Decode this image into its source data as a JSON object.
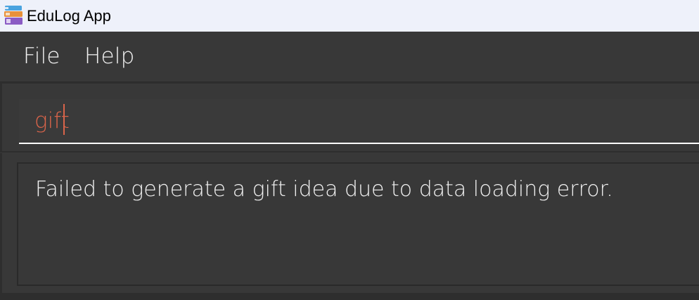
{
  "window": {
    "title": "EduLog App",
    "icon": "books-icon"
  },
  "menubar": {
    "items": [
      {
        "label": "File"
      },
      {
        "label": "Help"
      }
    ]
  },
  "command": {
    "value": "gift",
    "text_color": "#d9644a"
  },
  "result": {
    "message": "Failed to generate a gift idea due to data loading error."
  }
}
